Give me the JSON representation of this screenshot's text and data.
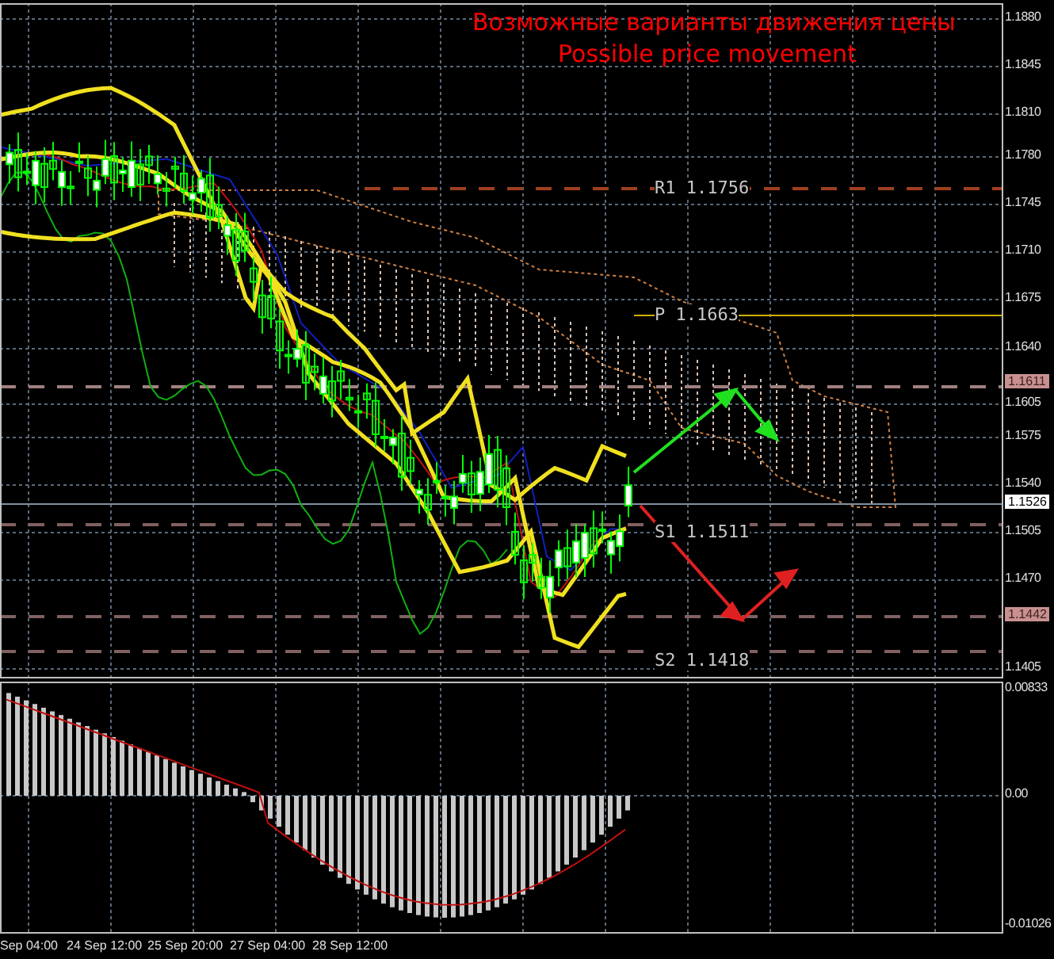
{
  "chart_title": {
    "line_1": "Возможные варианты движения цены",
    "line_2": "Possible price movement"
  },
  "price_axis": [
    "1.1880",
    "1.1845",
    "1.1810",
    "1.1780",
    "1.1745",
    "1.1710",
    "1.1675",
    "1.1640",
    "1.1605",
    "1.1575",
    "1.1540",
    "1.1505",
    "1.1470",
    "1.1405"
  ],
  "level_lines": [
    {
      "label": "R1 1.1756"
    },
    {
      "label": "P 1.1663"
    },
    {
      "label": "S1 1.1511"
    },
    {
      "label": "S2 1.1418"
    }
  ],
  "price_tags": [
    {
      "value": "1.1611",
      "kind": "level"
    },
    {
      "value": "1.1526",
      "kind": "bid"
    },
    {
      "value": "1.1442",
      "kind": "level"
    }
  ],
  "oscillator_axis": [
    "0.00833",
    "0.00",
    "-0.01026"
  ],
  "time_axis": [
    "Sep 04:00",
    "24 Sep 12:00",
    "25 Sep 20:00",
    "27 Sep 04:00",
    "28 Sep 12:00"
  ]
}
